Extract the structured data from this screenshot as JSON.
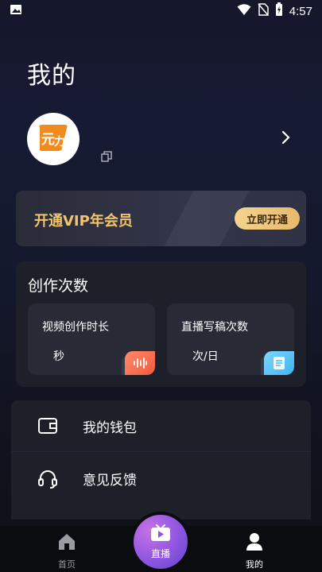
{
  "status_bar": {
    "time": "4:57",
    "icons": [
      "image-icon",
      "wifi-icon",
      "no-sim-icon",
      "battery-charging-icon"
    ]
  },
  "page": {
    "title": "我的"
  },
  "profile": {
    "avatar_icon": "app-logo-icon",
    "copy_icon": "copy-icon",
    "chevron_icon": "chevron-right-icon"
  },
  "vip": {
    "title": "开通VIP年会员",
    "button_label": "立即开通",
    "title_color": "#f3c46b",
    "button_color": "#f0c87c"
  },
  "creation": {
    "title": "创作次数",
    "cards": [
      {
        "label": "视频创作时长",
        "unit": "秒",
        "icon": "audio-wave-icon",
        "color": "#f26a4b"
      },
      {
        "label": "直播写稿次数",
        "unit": "次/日",
        "icon": "document-icon",
        "color": "#4fbff2"
      }
    ]
  },
  "menu": {
    "items": [
      {
        "label": "我的钱包",
        "icon": "wallet-icon"
      },
      {
        "label": "意见反馈",
        "icon": "headset-icon"
      }
    ]
  },
  "tabs": {
    "home": {
      "label": "首页",
      "icon": "home-icon"
    },
    "live": {
      "label": "直播",
      "icon": "tv-play-icon",
      "color": "#9b5de5"
    },
    "mine": {
      "label": "我的",
      "icon": "user-icon"
    }
  }
}
